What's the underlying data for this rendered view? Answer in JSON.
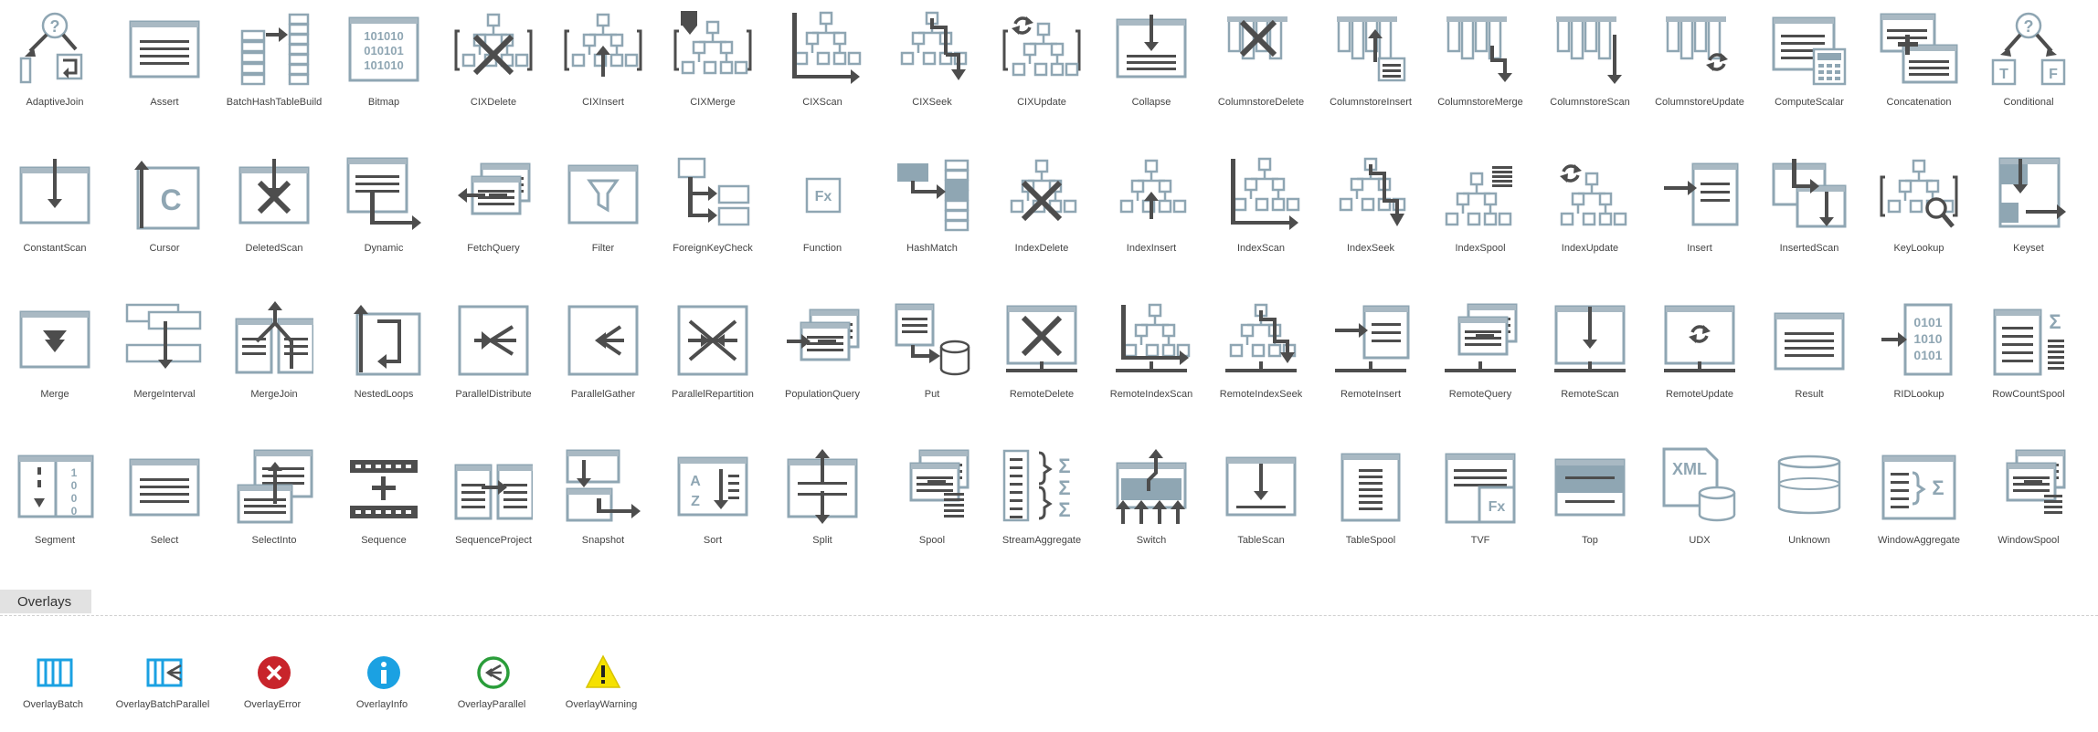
{
  "rows": [
    [
      "AdaptiveJoin",
      "Assert",
      "BatchHashTableBuild",
      "Bitmap",
      "CIXDelete",
      "CIXInsert",
      "CIXMerge",
      "CIXScan",
      "CIXSeek",
      "CIXUpdate",
      "Collapse",
      "ColumnstoreDelete",
      "ColumnstoreInsert",
      "ColumnstoreMerge",
      "ColumnstoreScan",
      "ColumnstoreUpdate",
      "ComputeScalar",
      "Concatenation",
      "Conditional"
    ],
    [
      "ConstantScan",
      "Cursor",
      "DeletedScan",
      "Dynamic",
      "FetchQuery",
      "Filter",
      "ForeignKeyCheck",
      "Function",
      "HashMatch",
      "IndexDelete",
      "IndexInsert",
      "IndexScan",
      "IndexSeek",
      "IndexSpool",
      "IndexUpdate",
      "Insert",
      "InsertedScan",
      "KeyLookup",
      "Keyset"
    ],
    [
      "Merge",
      "MergeInterval",
      "MergeJoin",
      "NestedLoops",
      "ParallelDistribute",
      "ParallelGather",
      "ParallelRepartition",
      "PopulationQuery",
      "Put",
      "RemoteDelete",
      "RemoteIndexScan",
      "RemoteIndexSeek",
      "RemoteInsert",
      "RemoteQuery",
      "RemoteScan",
      "RemoteUpdate",
      "Result",
      "RIDLookup",
      "RowCountSpool"
    ],
    [
      "Segment",
      "Select",
      "SelectInto",
      "Sequence",
      "SequenceProject",
      "Snapshot",
      "Sort",
      "Split",
      "Spool",
      "StreamAggregate",
      "Switch",
      "TableScan",
      "TableSpool",
      "TVF",
      "Top",
      "UDX",
      "Unknown",
      "WindowAggregate",
      "WindowSpool"
    ]
  ],
  "glyphs": {
    "AdaptiveJoin": "?",
    "Bitmap": "101010",
    "Cursor": "C",
    "Function": "Fx",
    "Conditional": "?",
    "Conditional_t": "T",
    "Conditional_f": "F",
    "RIDLookup": "0101",
    "Sort_a": "A",
    "Sort_z": "Z",
    "TVF": "Fx",
    "UDX": "XML",
    "Segment": "1000"
  },
  "overlays": {
    "title": "Overlays",
    "items": [
      {
        "label": "OverlayBatch",
        "icon": "batch"
      },
      {
        "label": "OverlayBatchParallel",
        "icon": "batch-parallel"
      },
      {
        "label": "OverlayError",
        "icon": "error"
      },
      {
        "label": "OverlayInfo",
        "icon": "info"
      },
      {
        "label": "OverlayParallel",
        "icon": "parallel"
      },
      {
        "label": "OverlayWarning",
        "icon": "warning"
      }
    ]
  },
  "colors": {
    "icon_light": "#8fa6b3",
    "icon_dark": "#4d4d4d",
    "header_band": "#a9b9c3",
    "overlay_blue": "#1ba1e2",
    "overlay_red": "#c8242b",
    "overlay_green": "#2a9d3a",
    "overlay_yellow": "#f5e100"
  }
}
